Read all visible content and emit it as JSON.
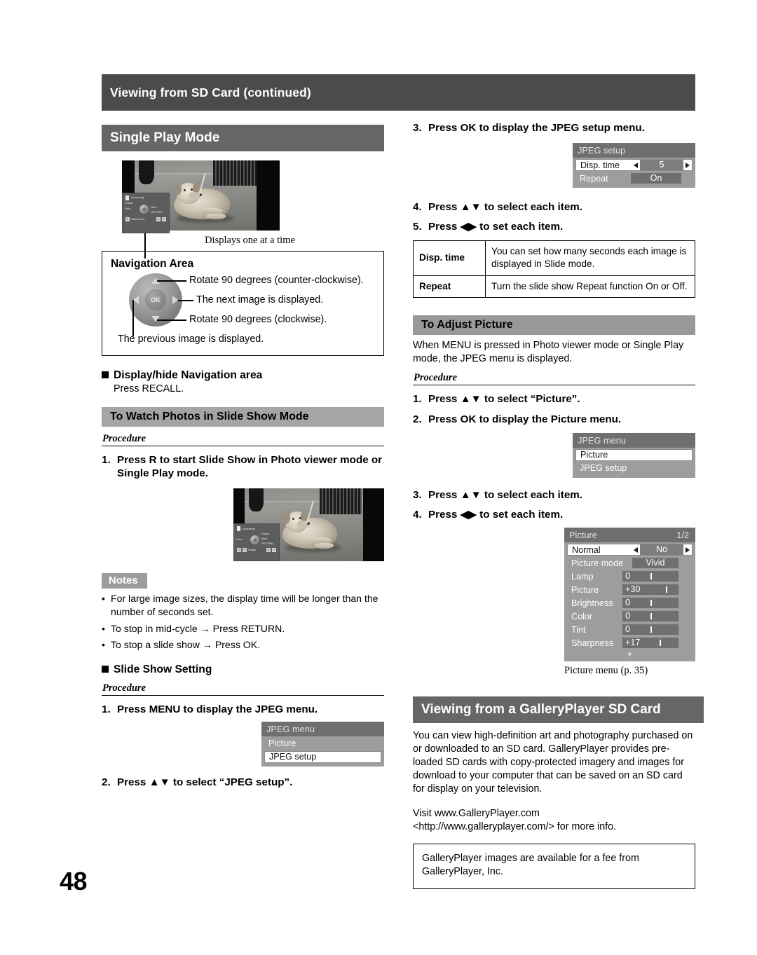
{
  "running_head": "Viewing from SD Card (continued)",
  "page_number": "48",
  "left_column": {
    "single_play": {
      "header": "Single Play Mode",
      "figure_caption": "Displays one at a time",
      "osd_overlay": {
        "status": "Accessing",
        "rotate_label": "Rotate",
        "prev_label": "Prev.",
        "next_label": "Next",
        "return_label": "RETURN",
        "slideshow_label": "Slide show",
        "keys": [
          "R",
          "G",
          "Y"
        ]
      },
      "navigation_area": {
        "title": "Navigation Area",
        "ok_label": "OK",
        "up_text": "Rotate 90 degrees (counter-clockwise).",
        "right_text": "The next image is displayed.",
        "down_text": "Rotate 90 degrees (clockwise).",
        "left_text": "The previous image is displayed."
      },
      "display_hide": {
        "title": "Display/hide Navigation area",
        "body": "Press RECALL."
      }
    },
    "slide_show": {
      "header": "To Watch Photos in Slide Show Mode",
      "procedure_label": "Procedure",
      "step1": {
        "num": "1.",
        "text": "Press R to start Slide Show in Photo viewer mode or Single Play mode."
      },
      "osd_overlay": {
        "status": "Accessing",
        "prev_label": "Prev.",
        "pause_label": "Pause",
        "next_label": "Next",
        "return_label": "RETURN",
        "single_label": "Single",
        "keys_left": [
          "R",
          "G"
        ],
        "keys_right": [
          "B",
          "Y"
        ]
      },
      "notes_tag": "Notes",
      "notes": [
        "For large image sizes, the display time will be longer than the number of seconds set.",
        "To stop in mid-cycle → Press RETURN.",
        "To stop a slide show → Press OK."
      ],
      "setting_title": "Slide Show Setting",
      "setting_procedure_label": "Procedure",
      "setting_step1": {
        "num": "1.",
        "text": "Press MENU to display the JPEG menu."
      },
      "jpeg_menu": {
        "title": "JPEG menu",
        "items": [
          {
            "label": "Picture",
            "state": "gray"
          },
          {
            "label": "JPEG setup",
            "state": "white"
          }
        ]
      },
      "setting_step2": {
        "num": "2.",
        "text": "Press ▲▼ to select “JPEG setup”."
      }
    }
  },
  "right_column": {
    "jpeg_setup_steps": {
      "step3": {
        "num": "3.",
        "text": "Press OK to display the JPEG setup menu."
      },
      "step4": {
        "num": "4.",
        "text": "Press ▲▼ to select each item."
      },
      "step5": {
        "num": "5.",
        "text": "Press ◀▶ to set each item."
      }
    },
    "jpeg_setup_osd": {
      "title": "JPEG setup",
      "rows": [
        {
          "label": "Disp. time",
          "value": "5",
          "state": "white",
          "arrows": true
        },
        {
          "label": "Repeat",
          "value": "On",
          "state": "gray",
          "arrows": false
        }
      ]
    },
    "setup_table": [
      {
        "key": "Disp. time",
        "desc": "You can set how many seconds each image is displayed in Slide mode."
      },
      {
        "key": "Repeat",
        "desc": "Turn the slide show Repeat function On or Off."
      }
    ],
    "adjust_picture": {
      "header": "To Adjust Picture",
      "intro": "When MENU is pressed in Photo viewer mode or Single Play mode, the JPEG menu is displayed.",
      "procedure_label": "Procedure",
      "step1": {
        "num": "1.",
        "text": "Press ▲▼ to select “Picture”."
      },
      "step2": {
        "num": "2.",
        "text": "Press OK to display the Picture menu."
      },
      "jpeg_menu": {
        "title": "JPEG menu",
        "items": [
          {
            "label": "Picture",
            "state": "white"
          },
          {
            "label": "JPEG setup",
            "state": "gray"
          }
        ]
      },
      "step3": {
        "num": "3.",
        "text": "Press ▲▼ to select each item."
      },
      "step4": {
        "num": "4.",
        "text": "Press ◀▶ to set each item."
      },
      "picture_osd": {
        "title": "Picture",
        "page_indicator": "1/2",
        "rows": [
          {
            "label": "Normal",
            "value": "No",
            "state": "white",
            "type": "arrows"
          },
          {
            "label": "Picture mode",
            "value": "Vivid",
            "state": "gray",
            "type": "plain"
          },
          {
            "label": "Lamp",
            "value": "0",
            "state": "gray",
            "type": "slider",
            "tick": 50
          },
          {
            "label": "Picture",
            "value": "+30",
            "state": "gray",
            "type": "slider",
            "tick": 78
          },
          {
            "label": "Brightness",
            "value": "0",
            "state": "gray",
            "type": "slider",
            "tick": 50
          },
          {
            "label": "Color",
            "value": "0",
            "state": "gray",
            "type": "slider",
            "tick": 50
          },
          {
            "label": "Tint",
            "value": "0",
            "state": "gray",
            "type": "slider",
            "tick": 50
          },
          {
            "label": "Sharpness",
            "value": "+17",
            "state": "gray",
            "type": "slider",
            "tick": 66
          }
        ],
        "more_indicator": "▼"
      },
      "figure_caption": "Picture menu (p. 35)"
    },
    "gallery_player": {
      "header": "Viewing from a GalleryPlayer SD Card",
      "body1": "You can view high-definition art and photography purchased on or downloaded to an SD card. GalleryPlayer provides pre-loaded SD cards with copy-protected imagery and images for download to your computer that can be saved on an SD card for display on your television.",
      "body2_line1": "Visit www.GalleryPlayer.com",
      "body2_line2": "<http://www.galleryplayer.com/> for more info.",
      "box_text": "GalleryPlayer images are available for a fee from GalleryPlayer, Inc."
    }
  },
  "colors": {
    "running_head_bg": "#4b4b4b",
    "header_dark_bg": "#666666",
    "header_mid_bg": "#a5a5a5",
    "header_light_bg": "#999999",
    "osd_body_bg": "#9d9d9d",
    "osd_title_bg": "#6f6f6f",
    "osd_value_bg": "#7d7d7d"
  }
}
